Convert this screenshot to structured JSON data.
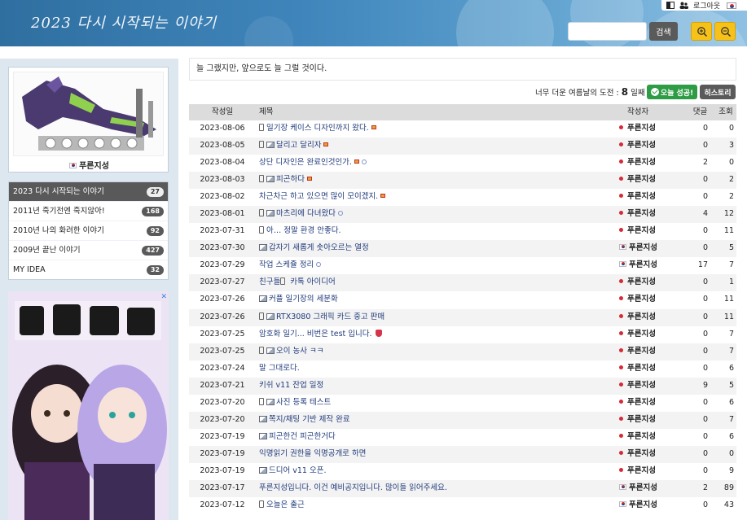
{
  "header": {
    "site_title": "2023 다시 시작되는 이야기",
    "search_placeholder": "",
    "search_label": "검색",
    "zoom_in_icon": "zoom-in-icon",
    "zoom_out_icon": "zoom-out-icon",
    "accent_color": "#f6c21a"
  },
  "util": {
    "logout_label": "로그아웃"
  },
  "sidebar": {
    "profile_name": "푸른지성",
    "categories": [
      {
        "label": "2023 다시 시작되는 이야기",
        "count": "27"
      },
      {
        "label": "2011년 죽기전엔 죽지않아!",
        "count": "168"
      },
      {
        "label": "2010년 나의 화려한 이야기",
        "count": "92"
      },
      {
        "label": "2009년 끝난 이야기",
        "count": "427"
      },
      {
        "label": "MY IDEA",
        "count": "32"
      }
    ],
    "ad_close": "✕"
  },
  "main": {
    "notice": "늘 그랬지만, 앞으로도 늘 그럴 것이다.",
    "challenge_prefix": "너무 더운 여름날의 도전 :",
    "challenge_days": "8",
    "challenge_suffix": "일째",
    "success_label": "오늘 성공!",
    "history_label": "히스토리"
  },
  "table": {
    "headers": {
      "date": "작성일",
      "title": "제목",
      "author": "작성자",
      "comments": "댓글",
      "views": "조회"
    },
    "rows": [
      {
        "date": "2023-08-06",
        "title": "일기장 케이스 디자인까지 왔다.",
        "author": "푸른지성",
        "comments": "0",
        "views": "0"
      },
      {
        "date": "2023-08-05",
        "title": "달리고 달리자",
        "author": "푸른지성",
        "comments": "0",
        "views": "3"
      },
      {
        "date": "2023-08-04",
        "title": "상단 디자인은 완료인것인가.",
        "author": "푸른지성",
        "comments": "2",
        "views": "0"
      },
      {
        "date": "2023-08-03",
        "title": "피곤하다",
        "author": "푸른지성",
        "comments": "0",
        "views": "2"
      },
      {
        "date": "2023-08-02",
        "title": "차근차근 하고 있으면 많이 모이겠지.",
        "author": "푸른지성",
        "comments": "0",
        "views": "2"
      },
      {
        "date": "2023-08-01",
        "title": "마츠리에 다녀왔다",
        "author": "푸른지성",
        "comments": "4",
        "views": "12"
      },
      {
        "date": "2023-07-31",
        "title": "아… 정말 환경 안좋다.",
        "author": "푸른지성",
        "comments": "0",
        "views": "11"
      },
      {
        "date": "2023-07-30",
        "title": "갑자기 새롭게 솟아오르는 열정",
        "author": "푸른지성",
        "comments": "0",
        "views": "5"
      },
      {
        "date": "2023-07-29",
        "title": "작업 스케쥴 정리",
        "author": "푸른지성",
        "comments": "17",
        "views": "7"
      },
      {
        "date": "2023-07-27",
        "title": "친구들 카톡 아이디어",
        "author": "푸른지성",
        "comments": "0",
        "views": "1"
      },
      {
        "date": "2023-07-26",
        "title": "커플 일기장의 세분화",
        "author": "푸른지성",
        "comments": "0",
        "views": "11"
      },
      {
        "date": "2023-07-26",
        "title": "RTX3080 그래픽 카드 중고 판매",
        "author": "푸른지성",
        "comments": "0",
        "views": "11"
      },
      {
        "date": "2023-07-25",
        "title": "암호화 일기... 비번은 test 입니다.",
        "author": "푸른지성",
        "comments": "0",
        "views": "7"
      },
      {
        "date": "2023-07-25",
        "title": "오이 농사 ㅋㅋ",
        "author": "푸른지성",
        "comments": "0",
        "views": "7"
      },
      {
        "date": "2023-07-24",
        "title": "말 그대로다.",
        "author": "푸른지성",
        "comments": "0",
        "views": "6"
      },
      {
        "date": "2023-07-21",
        "title": "키쉬 v11 잔업 일정",
        "author": "푸른지성",
        "comments": "9",
        "views": "5"
      },
      {
        "date": "2023-07-20",
        "title": "사진 등록 테스트",
        "author": "푸른지성",
        "comments": "0",
        "views": "6"
      },
      {
        "date": "2023-07-20",
        "title": "쪽지/채팅 기반 제작 완료",
        "author": "푸른지성",
        "comments": "0",
        "views": "7"
      },
      {
        "date": "2023-07-19",
        "title": "피곤한건 피곤한거다",
        "author": "푸른지성",
        "comments": "0",
        "views": "6"
      },
      {
        "date": "2023-07-19",
        "title": "읽기 권한을 익명공개로 하면",
        "title_prefix": "익명",
        "author": "푸른지성",
        "comments": "0",
        "views": "0"
      },
      {
        "date": "2023-07-19",
        "title": "드디어 v11 오픈.",
        "author": "푸른지성",
        "comments": "0",
        "views": "9"
      },
      {
        "date": "2023-07-17",
        "title": "푸른지성입니다. 이건 예비공지입니다. 많이들 읽어주세요.",
        "author": "푸른지성",
        "comments": "2",
        "views": "89"
      },
      {
        "date": "2023-07-12",
        "title": "오늘은 출근",
        "author": "푸른지성",
        "comments": "0",
        "views": "43"
      }
    ]
  }
}
